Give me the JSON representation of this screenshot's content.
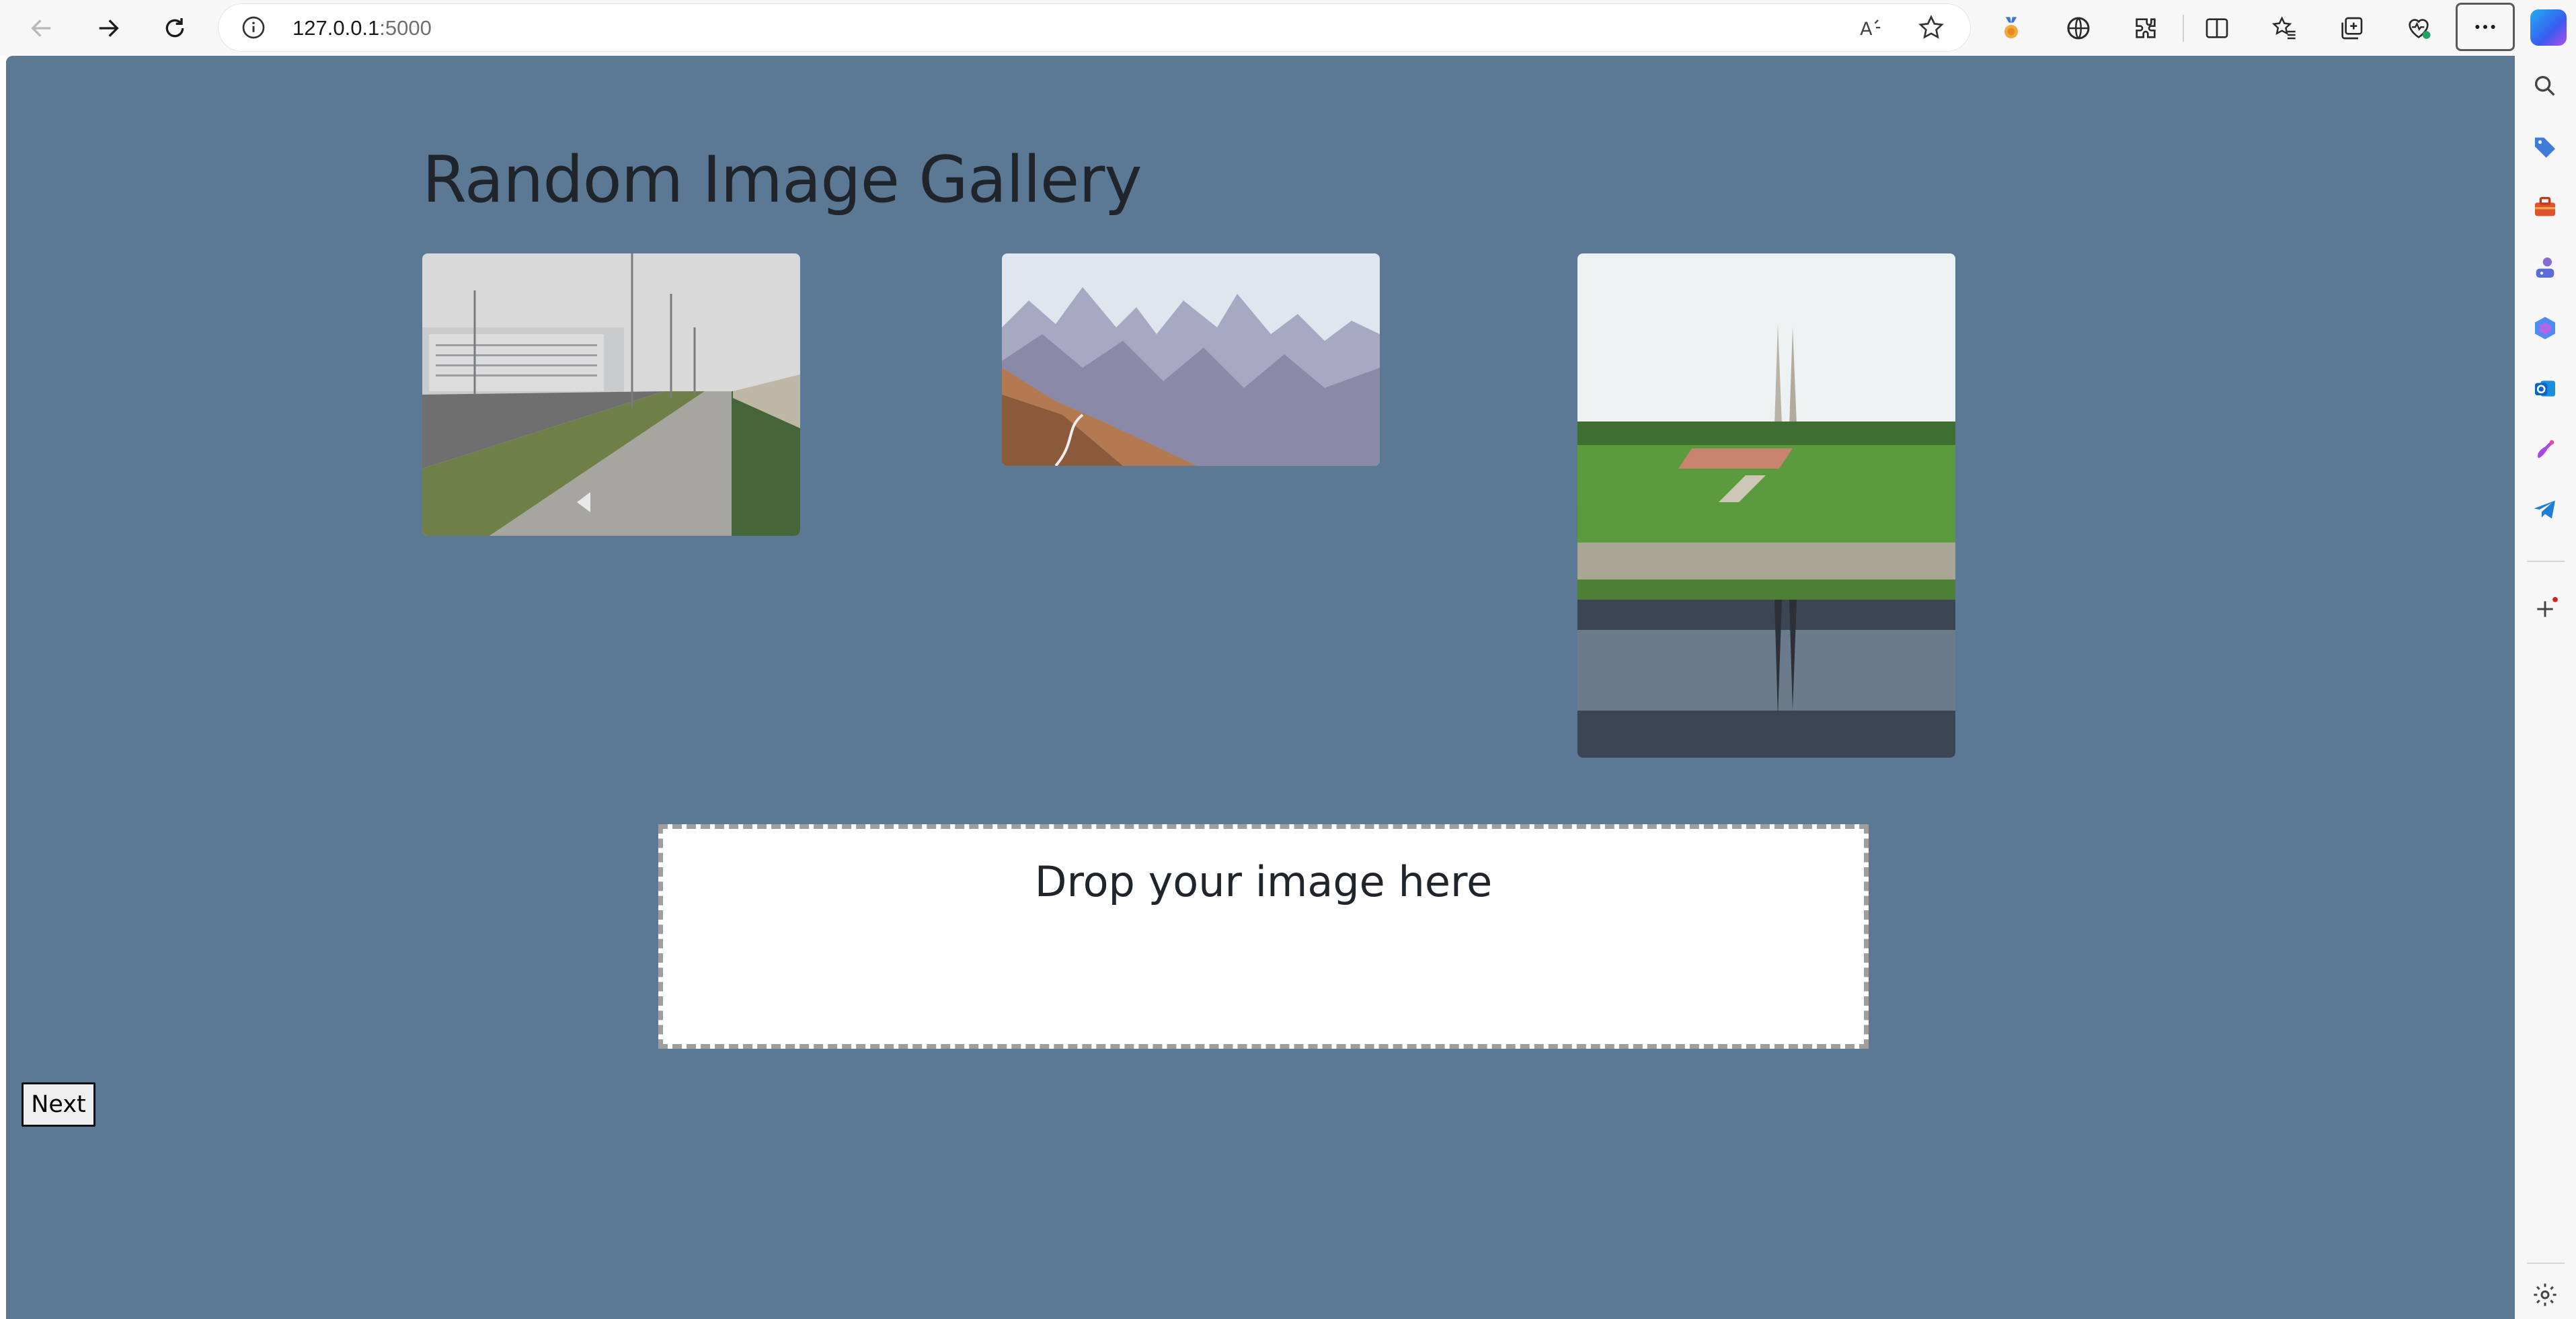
{
  "browser": {
    "url_host": "127.0.0.1",
    "url_port": ":5000",
    "icons": {
      "back": "back-arrow-icon",
      "forward": "forward-arrow-icon",
      "reload": "reload-icon",
      "site_info": "info-icon",
      "read_aloud": "read-aloud-icon",
      "favorite": "star-icon",
      "more": "more-options-icon"
    }
  },
  "page": {
    "title": "Random Image Gallery",
    "background_color": "#5b7894",
    "gallery": [
      {
        "subject": "city-road-with-sidewalk-and-lampposts"
      },
      {
        "subject": "mountain-range-with-winding-road"
      },
      {
        "subject": "twin-spire-monument-reflected-in-river"
      }
    ],
    "drop_zone": {
      "label": "Drop your image here"
    },
    "next_button": {
      "label": "Next"
    }
  },
  "sidebar": {
    "icons": [
      "search-icon",
      "tag-icon",
      "toolbox-icon",
      "games-icon",
      "m365-icon",
      "outlook-icon",
      "designer-icon",
      "telegram-icon",
      "add-icon",
      "settings-icon"
    ]
  }
}
